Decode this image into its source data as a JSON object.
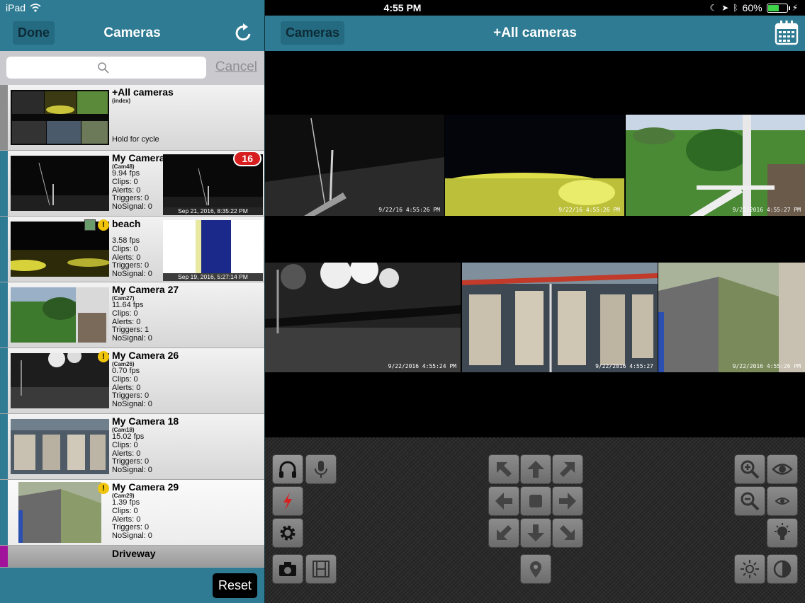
{
  "status_bar": {
    "device": "iPad",
    "time": "4:55 PM",
    "battery_pct": "60%",
    "battery_level": 0.6
  },
  "left": {
    "done_label": "Done",
    "title": "Cameras",
    "search_placeholder": "",
    "cancel_label": "Cancel",
    "reset_label": "Reset",
    "cameras": [
      {
        "name": "+All cameras",
        "sub": "(index)",
        "hold": "Hold for cycle",
        "stripe": "#8d8d8d"
      },
      {
        "name": "My Camera 48",
        "sub": "(Cam48)",
        "fps": "9.94 fps",
        "clips": "Clips: 0",
        "alerts": "Alerts: 0",
        "triggers": "Triggers: 0",
        "nosignal": "NoSignal: 0",
        "badge": "16",
        "alert_time": "Sep 21, 2016, 8:35:22 PM"
      },
      {
        "name": "beach",
        "sub": "",
        "fps": "3.58 fps",
        "clips": "Clips: 0",
        "alerts": "Alerts: 0",
        "triggers": "Triggers: 0",
        "nosignal": "NoSignal: 0",
        "alert_time": "Sep 19, 2016, 5:27:14 PM"
      },
      {
        "name": "My Camera 27",
        "sub": "(Cam27)",
        "fps": "11.64 fps",
        "clips": "Clips: 0",
        "alerts": "Alerts: 0",
        "triggers": "Triggers: 1",
        "nosignal": "NoSignal: 0"
      },
      {
        "name": "My Camera 26",
        "sub": "(Cam26)",
        "fps": "0.70 fps",
        "clips": "Clips: 0",
        "alerts": "Alerts: 0",
        "triggers": "Triggers: 0",
        "nosignal": "NoSignal: 0"
      },
      {
        "name": "My Camera 18",
        "sub": "(Cam18)",
        "fps": "15.02 fps",
        "clips": "Clips: 0",
        "alerts": "Alerts: 0",
        "triggers": "Triggers: 0",
        "nosignal": "NoSignal: 0"
      },
      {
        "name": "My Camera 29",
        "sub": "(Cam29)",
        "fps": "1.39 fps",
        "clips": "Clips: 0",
        "alerts": "Alerts: 0",
        "triggers": "Triggers: 0",
        "nosignal": "NoSignal: 0"
      },
      {
        "name": "Driveway",
        "stripe": "#a0139a"
      }
    ]
  },
  "right": {
    "cameras_label": "Cameras",
    "title": "+All cameras",
    "tiles": [
      {
        "stamp": "9/22/16 4:55:26 PM"
      },
      {
        "stamp": "9/22/16 4:55:26 PM"
      },
      {
        "stamp": "9/22/2016 4:55:27 PM"
      },
      {
        "stamp": "9/22/2016 4:55:24 PM"
      },
      {
        "stamp": "9/22/2016 4:55:27"
      },
      {
        "stamp": "9/22/2016 4:55:26 PM"
      }
    ]
  },
  "colors": {
    "nav_bar": "#2e7b93",
    "badge": "#d71f1f",
    "warning": "#f0c40a",
    "battery": "#3fd34a"
  }
}
